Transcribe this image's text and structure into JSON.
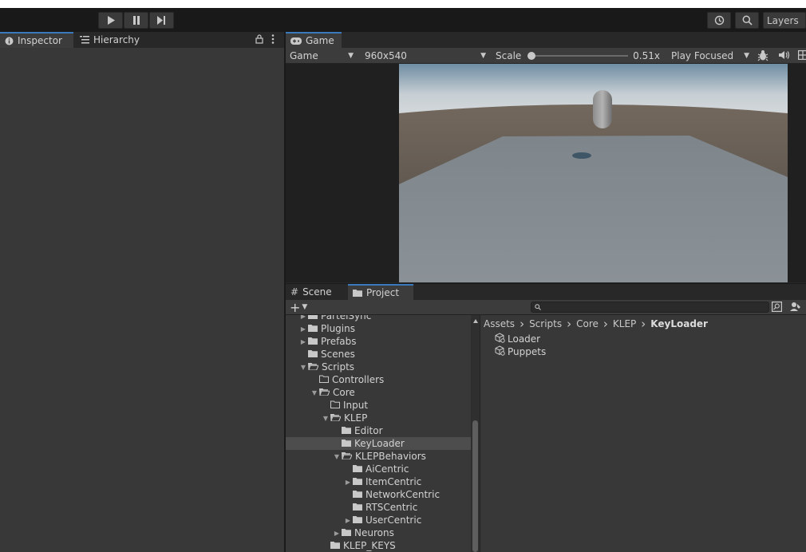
{
  "toolbar": {
    "play_icon": "play-icon",
    "pause_icon": "pause-icon",
    "step_icon": "step-icon",
    "history_icon": "history-icon",
    "search_icon": "search-icon",
    "layers_label": "Layers"
  },
  "inspector_panel": {
    "tabs": [
      {
        "label": "Inspector",
        "icon": "info-icon"
      },
      {
        "label": "Hierarchy",
        "icon": "list-icon"
      }
    ],
    "lock_icon": "lock-icon",
    "menu_icon": "kebab-icon"
  },
  "game_view": {
    "tab_label": "Game",
    "display_select": "Game",
    "resolution_select": "960x540",
    "scale_label": "Scale",
    "scale_value": "0.51x",
    "scale_fraction": 0.0,
    "play_mode_select": "Play Focused",
    "gizmo_icons": [
      "bug-icon",
      "audio-icon",
      "stats-icon"
    ]
  },
  "lower_tabs": [
    {
      "label": "Scene",
      "icon": "hash-icon",
      "active": false
    },
    {
      "label": "Project",
      "icon": "folder-icon",
      "active": true
    }
  ],
  "project_toolbar": {
    "add_label": "+",
    "search_placeholder": ""
  },
  "tree": [
    {
      "label": "PartelSync",
      "depth": 1,
      "arrow": "right",
      "icon": "folder-filled",
      "cut": true
    },
    {
      "label": "Plugins",
      "depth": 1,
      "arrow": "right",
      "icon": "folder-filled"
    },
    {
      "label": "Prefabs",
      "depth": 1,
      "arrow": "right",
      "icon": "folder-filled"
    },
    {
      "label": "Scenes",
      "depth": 1,
      "arrow": "none",
      "icon": "folder-filled"
    },
    {
      "label": "Scripts",
      "depth": 1,
      "arrow": "down",
      "icon": "folder-open"
    },
    {
      "label": "Controllers",
      "depth": 2,
      "arrow": "none",
      "icon": "folder-empty"
    },
    {
      "label": "Core",
      "depth": 2,
      "arrow": "down",
      "icon": "folder-open"
    },
    {
      "label": "Input",
      "depth": 3,
      "arrow": "none",
      "icon": "folder-empty"
    },
    {
      "label": "KLEP",
      "depth": 3,
      "arrow": "down",
      "icon": "folder-open"
    },
    {
      "label": "Editor",
      "depth": 4,
      "arrow": "none",
      "icon": "folder-filled"
    },
    {
      "label": "KeyLoader",
      "depth": 4,
      "arrow": "none",
      "icon": "folder-filled",
      "selected": true
    },
    {
      "label": "KLEPBehaviors",
      "depth": 4,
      "arrow": "down",
      "icon": "folder-open"
    },
    {
      "label": "AiCentric",
      "depth": 5,
      "arrow": "none",
      "icon": "folder-filled"
    },
    {
      "label": "ItemCentric",
      "depth": 5,
      "arrow": "right",
      "icon": "folder-filled"
    },
    {
      "label": "NetworkCentric",
      "depth": 5,
      "arrow": "none",
      "icon": "folder-filled"
    },
    {
      "label": "RTSCentric",
      "depth": 5,
      "arrow": "none",
      "icon": "folder-filled"
    },
    {
      "label": "UserCentric",
      "depth": 5,
      "arrow": "right",
      "icon": "folder-filled"
    },
    {
      "label": "Neurons",
      "depth": 4,
      "arrow": "right",
      "icon": "folder-filled"
    },
    {
      "label": "KLEP_KEYS",
      "depth": 3,
      "arrow": "none",
      "icon": "folder-filled"
    }
  ],
  "breadcrumb": [
    "Assets",
    "Scripts",
    "Core",
    "KLEP",
    "KeyLoader"
  ],
  "files": [
    {
      "label": "Loader",
      "icon": "script-icon"
    },
    {
      "label": "Puppets",
      "icon": "script-icon"
    }
  ]
}
